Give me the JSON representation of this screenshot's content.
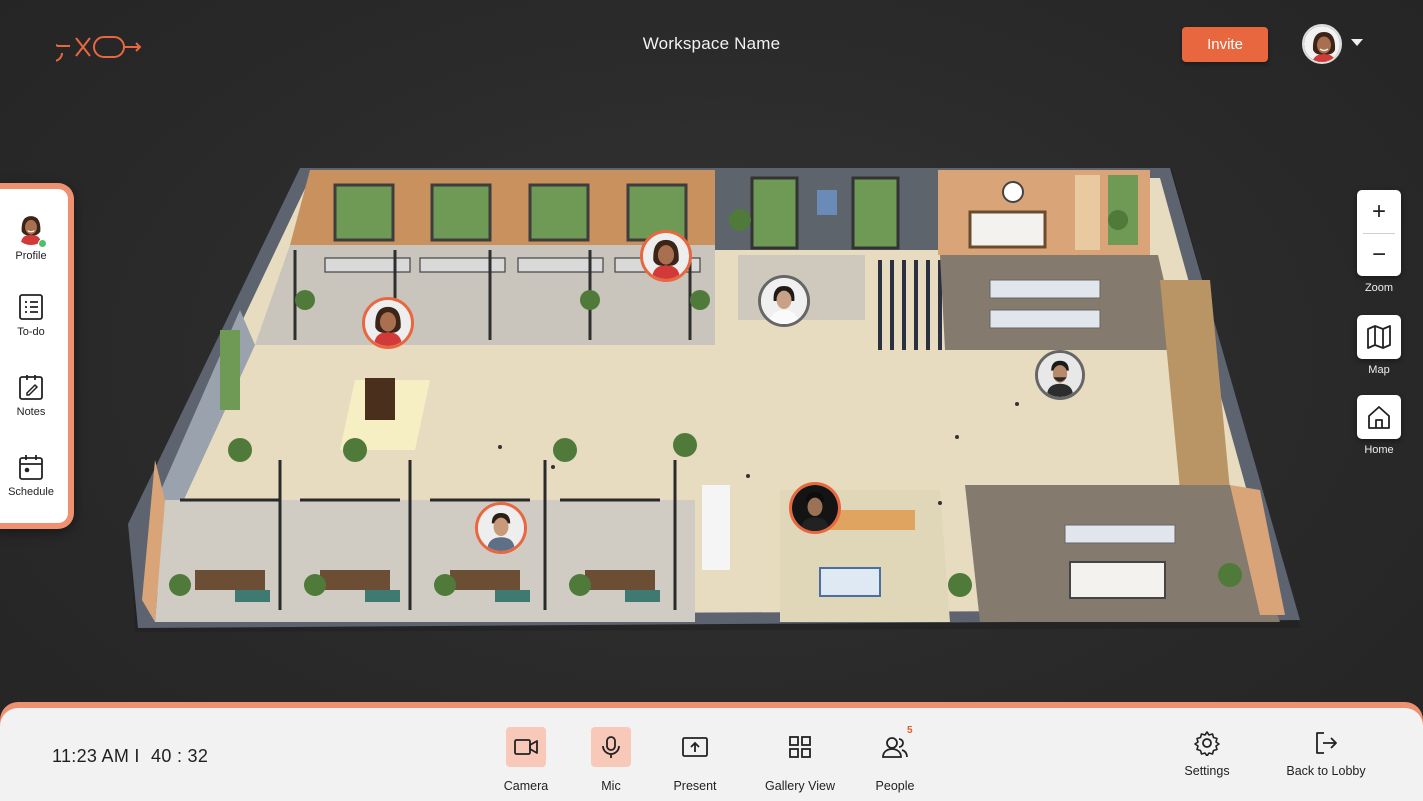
{
  "header": {
    "logo_text": "exo",
    "workspace_name": "Workspace Name",
    "invite_label": "Invite"
  },
  "sidebar": {
    "items": [
      {
        "label": "Profile",
        "icon": "avatar"
      },
      {
        "label": "To-do",
        "icon": "list-icon"
      },
      {
        "label": "Notes",
        "icon": "notes-icon"
      },
      {
        "label": "Schedule",
        "icon": "calendar-icon"
      }
    ],
    "status_color": "#49c06e"
  },
  "map_controls": {
    "zoom_in": "+",
    "zoom_out": "−",
    "zoom_label": "Zoom",
    "map_label": "Map",
    "home_label": "Home"
  },
  "bottom_bar": {
    "time": "11:23 AM I",
    "timer": "40 : 32",
    "actions": [
      {
        "label": "Camera",
        "icon": "camera-icon",
        "active": true
      },
      {
        "label": "Mic",
        "icon": "mic-icon",
        "active": true
      },
      {
        "label": "Present",
        "icon": "present-icon",
        "active": false
      },
      {
        "label": "Gallery View",
        "icon": "grid-icon",
        "active": false
      },
      {
        "label": "People",
        "icon": "people-icon",
        "active": false,
        "badge": "5"
      }
    ],
    "settings_label": "Settings",
    "back_label": "Back to Lobby"
  },
  "colors": {
    "accent": "#e9673f",
    "accent_light": "#ef9070",
    "active_bg": "#f8c9b8",
    "background": "#2a2a2a"
  }
}
